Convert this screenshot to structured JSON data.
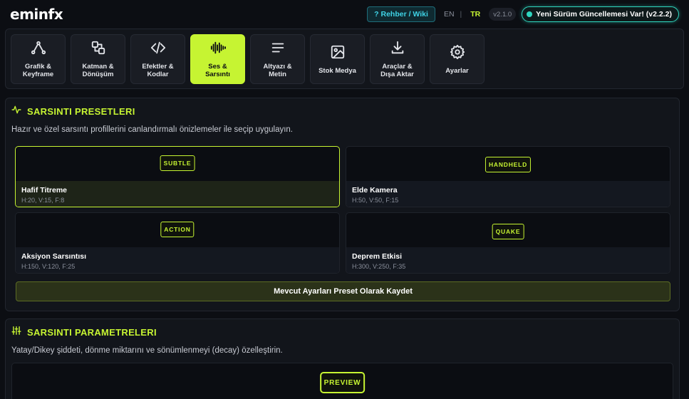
{
  "header": {
    "logo": "eminfx",
    "wiki_label": "? Rehber / Wiki",
    "lang_en": "EN",
    "lang_sep": "|",
    "lang_tr": "TR",
    "version": "v2.1.0",
    "update_label": "Yeni Sürüm Güncellemesi Var! (v2.2.2)"
  },
  "nav": {
    "items": [
      {
        "label": "Grafik &\nKeyframe",
        "icon": "graph-icon",
        "active": false
      },
      {
        "label": "Katman &\nDönüşüm",
        "icon": "layers-icon",
        "active": false
      },
      {
        "label": "Efektler &\nKodlar",
        "icon": "code-icon",
        "active": false
      },
      {
        "label": "Ses &\nSarsıntı",
        "icon": "audio-wave-icon",
        "active": true
      },
      {
        "label": "Altyazı &\nMetin",
        "icon": "text-lines-icon",
        "active": false
      },
      {
        "label": "Stok Medya",
        "icon": "image-icon",
        "active": false
      },
      {
        "label": "Araçlar &\nDışa Aktar",
        "icon": "download-icon",
        "active": false
      },
      {
        "label": "Ayarlar",
        "icon": "gear-icon",
        "active": false
      }
    ]
  },
  "presets_panel": {
    "title": "SARSINTI PRESETLERI",
    "description": "Hazır ve özel sarsıntı profillerini canlandırmalı önizlemeler ile seçip uygulayın.",
    "presets": [
      {
        "badge": "SUBTLE",
        "name": "Hafif Titreme",
        "params": "H:20, V:15, F:8",
        "selected": true
      },
      {
        "badge": "HANDHELD",
        "name": "Elde Kamera",
        "params": "H:50, V:50, F:15",
        "selected": false
      },
      {
        "badge": "ACTION",
        "name": "Aksiyon Sarsıntısı",
        "params": "H:150, V:120, F:25",
        "selected": false
      },
      {
        "badge": "QUAKE",
        "name": "Deprem Etkisi",
        "params": "H:300, V:250, F:35",
        "selected": false
      }
    ],
    "save_label": "Mevcut Ayarları Preset Olarak Kaydet"
  },
  "params_panel": {
    "title": "SARSINTI PARAMETRELERI",
    "description": "Yatay/Dikey şiddeti, dönme miktarını ve sönümlenmeyi (decay) özelleştirin.",
    "preview_badge": "PREVIEW"
  },
  "colors": {
    "accent": "#c6f432",
    "update_accent": "#2fd6bf",
    "wiki_accent": "#3fd3e6",
    "background": "#0c0e13"
  }
}
